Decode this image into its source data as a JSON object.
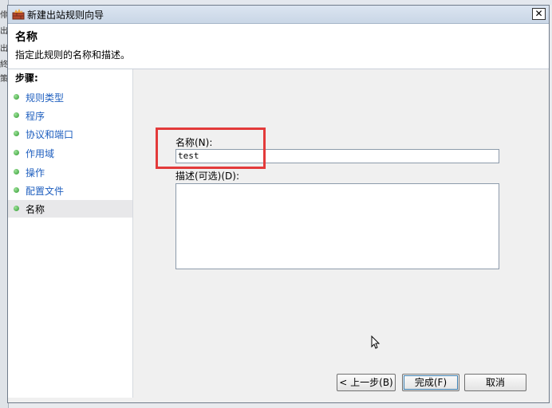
{
  "window": {
    "title": "新建出站规则向导",
    "close_symbol": "✕"
  },
  "header": {
    "title": "名称",
    "description": "指定此规则的名称和描述。"
  },
  "sidebar": {
    "steps_label": "步骤:",
    "items": [
      {
        "label": "规则类型"
      },
      {
        "label": "程序"
      },
      {
        "label": "协议和端口"
      },
      {
        "label": "作用域"
      },
      {
        "label": "操作"
      },
      {
        "label": "配置文件"
      },
      {
        "label": "名称"
      }
    ]
  },
  "form": {
    "name_label": "名称(N):",
    "name_value": "test",
    "desc_label": "描述(可选)(D):",
    "desc_value": ""
  },
  "buttons": {
    "back": "< 上一步(B)",
    "finish": "完成(F)",
    "cancel": "取消"
  },
  "background_fragments": [
    "俳",
    "出",
    "出",
    "終",
    "策"
  ],
  "colors": {
    "highlight": "#e33a3a",
    "link": "#1f5fbf",
    "step_dot": "#2f9a30"
  }
}
